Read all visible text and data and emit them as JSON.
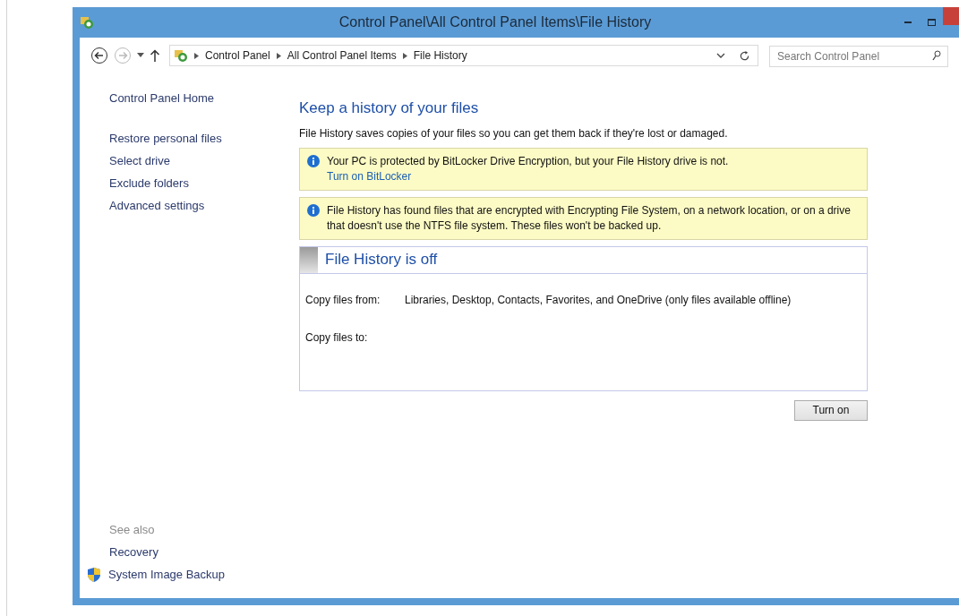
{
  "window": {
    "title": "Control Panel\\All Control Panel Items\\File History"
  },
  "navigation": {
    "back_enabled": true,
    "forward_enabled": false,
    "breadcrumb": [
      "Control Panel",
      "All Control Panel Items",
      "File History"
    ],
    "search": {
      "placeholder": "Search Control Panel"
    }
  },
  "sidebar": {
    "home": "Control Panel Home",
    "tasks": [
      "Restore personal files",
      "Select drive",
      "Exclude folders",
      "Advanced settings"
    ],
    "see_also": {
      "heading": "See also",
      "items": [
        {
          "label": "Recovery",
          "kind": "plain"
        },
        {
          "label": "System Image Backup",
          "kind": "shield"
        }
      ]
    }
  },
  "main": {
    "heading": "Keep a history of your files",
    "description": "File History saves copies of your files so you can get them back if they're lost or damaged.",
    "notices": [
      {
        "text": "Your PC is protected by BitLocker Drive Encryption, but your File History drive is not.",
        "link": "Turn on BitLocker"
      },
      {
        "text": "File History has found files that are encrypted with Encrypting File System, on a network location, or on a drive that doesn't use the NTFS file system. These files won't be backed up."
      }
    ],
    "status": {
      "title": "File History is off",
      "rows": [
        {
          "label": "Copy files from:",
          "value": "Libraries, Desktop, Contacts, Favorites, and OneDrive (only files available offline)"
        },
        {
          "label": "Copy files to:"
        }
      ]
    },
    "button": "Turn on"
  }
}
